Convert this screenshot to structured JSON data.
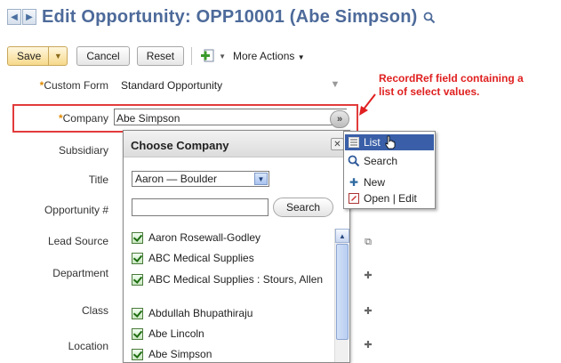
{
  "header": {
    "title": "Edit Opportunity: OPP10001 (Abe Simpson)",
    "back_icon": "back-arrow-icon",
    "forward_icon": "forward-arrow-icon",
    "search_icon": "search-icon"
  },
  "toolbar": {
    "save_label": "Save",
    "cancel_label": "Cancel",
    "reset_label": "Reset",
    "more_actions_label": "More Actions"
  },
  "form": {
    "custom_form_label": "Custom Form",
    "custom_form_value": "Standard Opportunity",
    "company_label": "Company",
    "company_value": "Abe Simpson",
    "subsidiary_label": "Subsidiary",
    "title_label": "Title",
    "opportunity_label": "Opportunity #",
    "lead_source_label": "Lead Source",
    "department_label": "Department",
    "class_label": "Class",
    "location_label": "Location",
    "required_marker": "*"
  },
  "annotation": {
    "line1": "RecordRef field containing a",
    "line2": "list of select values."
  },
  "popup": {
    "title": "Choose Company",
    "filter_value": "Aaron — Boulder",
    "search_placeholder": "",
    "search_button": "Search",
    "items": [
      {
        "label": "Aaron Rosewall-Godley"
      },
      {
        "label": "ABC Medical Supplies"
      },
      {
        "label": "ABC Medical Supplies : Stours, Allen"
      },
      {
        "label": "Abdullah Bhupathiraju"
      },
      {
        "label": "Abe Lincoln"
      },
      {
        "label": "Abe Simpson"
      }
    ]
  },
  "menu": {
    "items": [
      {
        "label": "List",
        "icon": "list-icon",
        "selected": true
      },
      {
        "label": "Search",
        "icon": "search-icon",
        "selected": false
      },
      {
        "label": "New",
        "icon": "plus-icon",
        "selected": false
      },
      {
        "label": "Open | Edit",
        "icon": "open-edit-icon",
        "selected": false
      }
    ]
  },
  "colors": {
    "title_blue": "#4d6a9a",
    "annotation_red": "#e02020",
    "required_orange": "#e08a00",
    "menu_selected": "#3a5fa8",
    "save_gold": "#f6d98a"
  }
}
